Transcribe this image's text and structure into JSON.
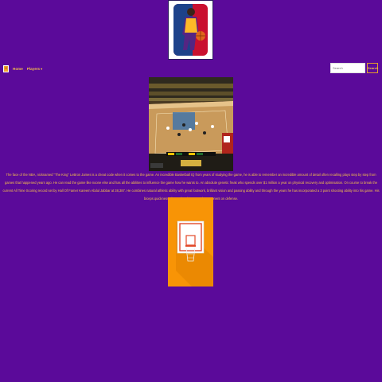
{
  "nav": {
    "home_label": "Home",
    "players_label": "Players"
  },
  "search": {
    "placeholder": "Search",
    "button_label": "Search"
  },
  "article": {
    "bio": "The face of the NBA, nicknamed \"The King\" LeBron James is a cheat code when it comes to the game. An incredible Basketball IQ from years of studying the game, he is able to remember an incredible amount of detail often recalling plays step by step from games that happened years ago. He can read the game like noone else and has all the abilities to influence the game how he wants to. An absolute genetic freak who spends over $1 million a year on physical recovery and optimisation. On course to break the current All Time Scoring record set by Hall Of Famer Kareem Abdul Jabbar at 38,387. He combines natural athletic ability with great footwork, brilliant vision and passing ability and through the years he has incorporated a 3 point shooting ability into his game. His biceps quickness also makes him a worthy opponent on defense."
  },
  "colors": {
    "background": "#5b0a9a",
    "accent": "#f4c14b",
    "card": "#f89406"
  }
}
